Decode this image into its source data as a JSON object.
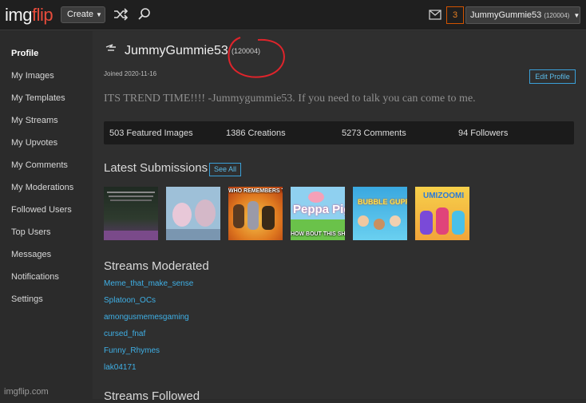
{
  "header": {
    "logo_part1": "img",
    "logo_part2": "flip",
    "create_label": "Create",
    "create_caret": "▼",
    "notification_count": "3",
    "username": "JummyGummie53",
    "user_points": "(120004)",
    "user_caret": "▼",
    "icons": [
      "shuffle-icon",
      "search-icon",
      "mail-icon",
      "chevron-down-icon"
    ]
  },
  "sidebar": {
    "items": [
      {
        "label": "Profile"
      },
      {
        "label": "My Images"
      },
      {
        "label": "My Templates"
      },
      {
        "label": "My Streams"
      },
      {
        "label": "My Upvotes"
      },
      {
        "label": "My Comments"
      },
      {
        "label": "My Moderations"
      },
      {
        "label": "Followed Users"
      },
      {
        "label": "Top Users"
      },
      {
        "label": "Messages"
      },
      {
        "label": "Notifications"
      },
      {
        "label": "Settings"
      }
    ],
    "active": "Profile",
    "footer": "imgflip.com"
  },
  "profile": {
    "username": "JummyGummie53",
    "points": "(120004)",
    "joined": "Joined 2020-11-16",
    "edit_label": "Edit Profile",
    "bio": "ITS TREND TIME!!!! -Jummygummie53. If you need to talk you can come to me.",
    "stats": {
      "featured": "503 Featured Images",
      "creations": "1386 Creations",
      "comments": "5273 Comments",
      "followers": "94 Followers"
    }
  },
  "submissions": {
    "title": "Latest Submissions",
    "see_all": "See All",
    "thumbs": [
      {
        "name": "thumb-text-meme",
        "caption": ""
      },
      {
        "name": "thumb-pinky-brain",
        "caption": ""
      },
      {
        "name": "thumb-looney-tunes",
        "caption": "WHO REMEMBERS THIS"
      },
      {
        "name": "thumb-peppa-pig",
        "caption": "HOW BOUT THIS SHOW",
        "title_text": "Peppa Pig"
      },
      {
        "name": "thumb-bubble-guppies",
        "caption": "",
        "title_text": "BUBBLE GUPPIES"
      },
      {
        "name": "thumb-team-umizoomi",
        "caption": "",
        "title_text": "UMIZOOMI"
      }
    ]
  },
  "streams_moderated": {
    "title": "Streams Moderated",
    "items": [
      "Meme_that_make_sense",
      "Splatoon_OCs",
      "amongusmemesgaming",
      "cursed_fnaf",
      "Funny_Rhymes",
      "lak04171"
    ]
  },
  "streams_followed": {
    "title": "Streams Followed"
  },
  "colors": {
    "accent": "#3aa0d8",
    "brand_red": "#e74c3c",
    "annotation_red": "#e0242b",
    "background": "#2f2f2f"
  }
}
